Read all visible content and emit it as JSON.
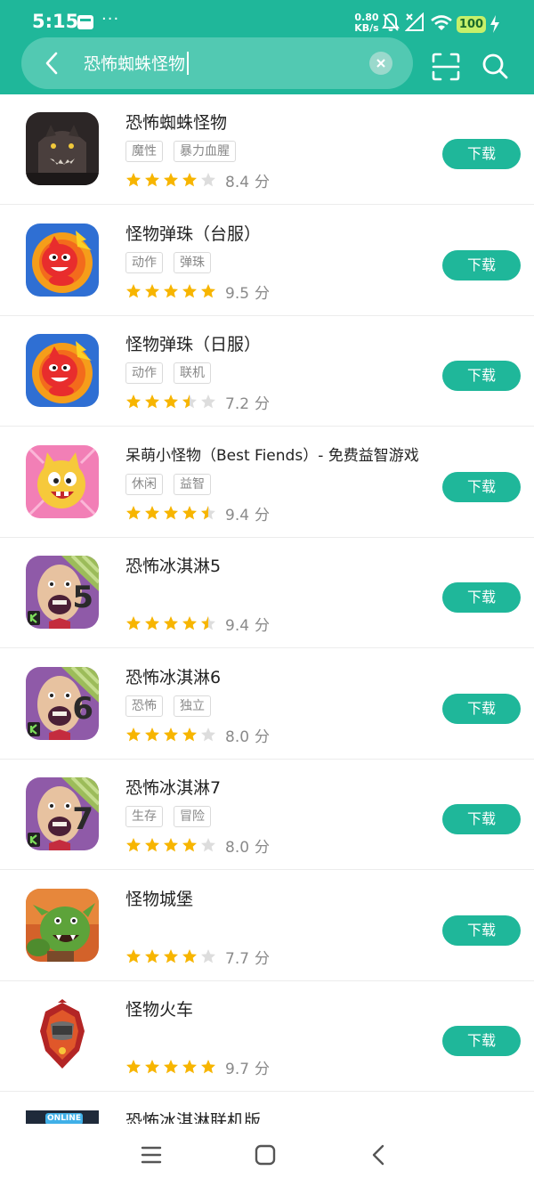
{
  "status": {
    "time": "5:15",
    "dots": "···",
    "net_speed_value": "0.80",
    "net_speed_unit": "KB/s",
    "battery": "100"
  },
  "search": {
    "query": "恐怖蜘蛛怪物"
  },
  "download_label": "下载",
  "score_unit": "分",
  "apps": [
    {
      "name": "恐怖蜘蛛怪物",
      "tags": [
        "魔性",
        "暴力血腥"
      ],
      "rating": 4,
      "score": "8.4",
      "icon": "spider-monster-icon"
    },
    {
      "name": "怪物弹珠（台服）",
      "tags": [
        "动作",
        "弹珠"
      ],
      "rating": 5,
      "score": "9.5",
      "icon": "monster-strike-icon"
    },
    {
      "name": "怪物弹珠（日服）",
      "tags": [
        "动作",
        "联机"
      ],
      "rating": 3.5,
      "score": "7.2",
      "icon": "monster-strike-icon"
    },
    {
      "name": "呆萌小怪物（Best Fiends）- 免费益智游戏",
      "tags": [
        "休闲",
        "益智"
      ],
      "rating": 4.5,
      "score": "9.4",
      "icon": "best-fiends-icon"
    },
    {
      "name": "恐怖冰淇淋5",
      "tags": [],
      "rating": 4.5,
      "score": "9.4",
      "icon": "ice-scream-5-icon",
      "badge": "5"
    },
    {
      "name": "恐怖冰淇淋6",
      "tags": [
        "恐怖",
        "独立"
      ],
      "rating": 4,
      "score": "8.0",
      "icon": "ice-scream-6-icon",
      "badge": "6"
    },
    {
      "name": "恐怖冰淇淋7",
      "tags": [
        "生存",
        "冒险"
      ],
      "rating": 4,
      "score": "8.0",
      "icon": "ice-scream-7-icon",
      "badge": "7"
    },
    {
      "name": "怪物城堡",
      "tags": [],
      "rating": 4,
      "score": "7.7",
      "icon": "monster-castle-icon"
    },
    {
      "name": "怪物火车",
      "tags": [],
      "rating": 5,
      "score": "9.7",
      "icon": "monster-train-icon"
    },
    {
      "name": "恐怖冰淇淋联机版",
      "tags": [],
      "rating": null,
      "score": "",
      "icon": "ice-scream-online-icon",
      "badge_text": "ONLINE"
    }
  ],
  "colors": {
    "accent": "#1fb79a",
    "star_on": "#f7b500",
    "star_off": "#dddddd"
  }
}
